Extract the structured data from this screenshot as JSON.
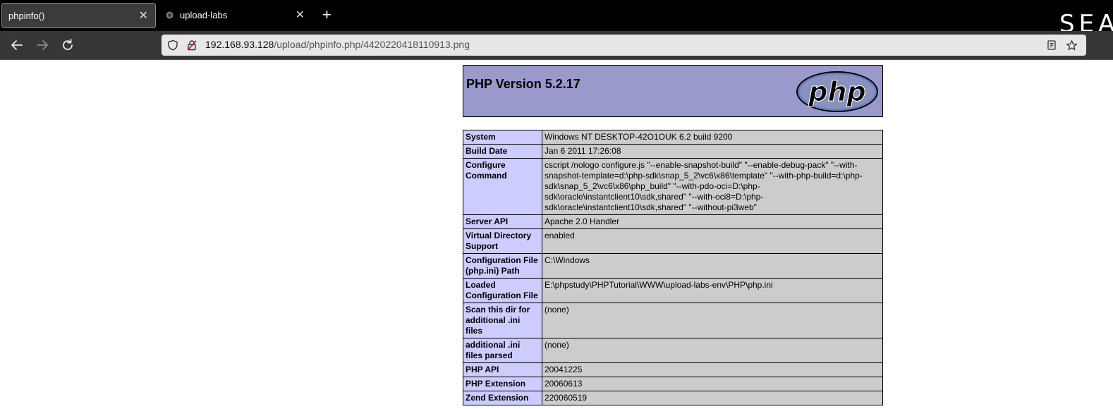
{
  "browser": {
    "tabs": [
      {
        "title": "phpinfo()",
        "active": true
      },
      {
        "title": "upload-labs",
        "active": false
      }
    ],
    "new_tab_symbol": "+",
    "close_symbol": "✕",
    "brand_mark": "SEA",
    "address": {
      "host": "192.168.93.128",
      "path": "/upload/phpinfo.php/4420220418110913.png"
    },
    "icons": [
      "back-arrow-icon",
      "forward-arrow-icon",
      "reload-icon",
      "shield-icon",
      "insecure-lock-icon",
      "reader-view-icon",
      "bookmark-star-icon"
    ]
  },
  "page": {
    "title": "PHP Version 5.2.17",
    "logo_text": "php",
    "rows": [
      {
        "key": "System",
        "value": "Windows NT DESKTOP-42O1OUK 6.2 build 9200"
      },
      {
        "key": "Build Date",
        "value": "Jan 6 2011 17:26:08"
      },
      {
        "key": "Configure Command",
        "value": "cscript /nologo configure.js \"--enable-snapshot-build\" \"--enable-debug-pack\" \"--with-snapshot-template=d:\\php-sdk\\snap_5_2\\vc6\\x86\\template\" \"--with-php-build=d:\\php-sdk\\snap_5_2\\vc6\\x86\\php_build\" \"--with-pdo-oci=D:\\php-sdk\\oracle\\instantclient10\\sdk,shared\" \"--with-oci8=D:\\php-sdk\\oracle\\instantclient10\\sdk,shared\" \"--without-pi3web\""
      },
      {
        "key": "Server API",
        "value": "Apache 2.0 Handler"
      },
      {
        "key": "Virtual Directory Support",
        "value": "enabled"
      },
      {
        "key": "Configuration File (php.ini) Path",
        "value": "C:\\Windows"
      },
      {
        "key": "Loaded Configuration File",
        "value": "E:\\phpstudy\\PHPTutorial\\WWW\\upload-labs-env\\PHP\\php.ini"
      },
      {
        "key": "Scan this dir for additional .ini files",
        "value": "(none)"
      },
      {
        "key": "additional .ini files parsed",
        "value": "(none)"
      },
      {
        "key": "PHP API",
        "value": "20041225"
      },
      {
        "key": "PHP Extension",
        "value": "20060613"
      },
      {
        "key": "Zend Extension",
        "value": "220060519"
      }
    ]
  },
  "colors": {
    "header_bg": "#9999cc",
    "key_bg": "#ccccff",
    "value_bg": "#cccccc"
  }
}
